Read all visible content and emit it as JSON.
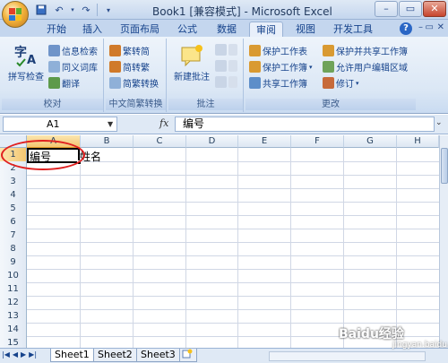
{
  "title_bar": {
    "title": "Book1  [兼容模式] - Microsoft Excel",
    "window_controls": [
      "minimize",
      "maximize",
      "close"
    ]
  },
  "ribbon_tabs": [
    {
      "label": "开始",
      "active": false
    },
    {
      "label": "插入",
      "active": false
    },
    {
      "label": "页面布局",
      "active": false
    },
    {
      "label": "公式",
      "active": false
    },
    {
      "label": "数据",
      "active": false
    },
    {
      "label": "审阅",
      "active": true
    },
    {
      "label": "视图",
      "active": false
    },
    {
      "label": "开发工具",
      "active": false
    }
  ],
  "ribbon": {
    "proofing": {
      "label": "校对",
      "spell_check": "拼写检查",
      "research": "信息检索",
      "thesaurus": "同义词库",
      "translate": "翻译"
    },
    "chinese_conversion": {
      "label": "中文简繁转换",
      "to_simplified": "繁转简",
      "to_traditional": "简转繁",
      "conversion": "简繁转换"
    },
    "comments": {
      "label": "批注",
      "new_comment": "新建批注"
    },
    "changes": {
      "label": "更改",
      "protect_sheet": "保护工作表",
      "protect_workbook": "保护工作簿",
      "share_workbook": "共享工作簿",
      "protect_share": "保护并共享工作簿",
      "allow_edit_ranges": "允许用户编辑区域",
      "track_changes": "修订"
    }
  },
  "formula_bar": {
    "name_box": "A1",
    "fx": "fx",
    "value": "编号"
  },
  "grid": {
    "columns": [
      "A",
      "B",
      "C",
      "D",
      "E",
      "F",
      "G",
      "H"
    ],
    "rows": [
      "1",
      "2",
      "3",
      "4",
      "5",
      "6",
      "7",
      "8",
      "9",
      "10",
      "11",
      "12",
      "13",
      "14",
      "15"
    ],
    "cells": {
      "A1": "编号",
      "B1": "姓名"
    },
    "selected_cell": "A1"
  },
  "sheet_tabs": [
    "Sheet1",
    "Sheet2",
    "Sheet3"
  ],
  "watermark": {
    "text": "Baidu经验",
    "sub": "jingyan.baidu.com"
  }
}
